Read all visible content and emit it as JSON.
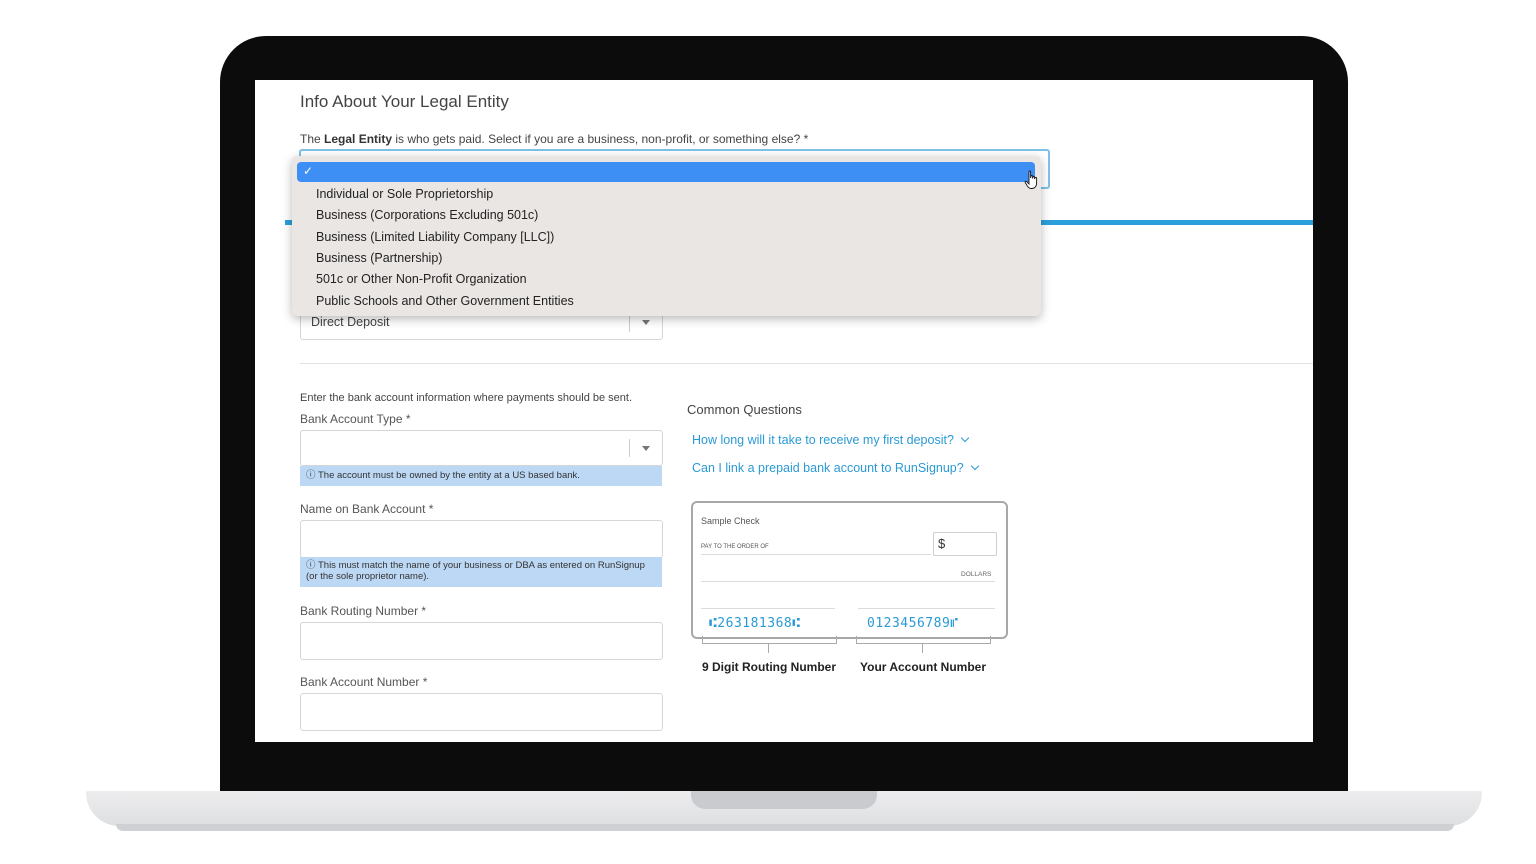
{
  "legal_entity": {
    "heading": "Info About Your Legal Entity",
    "prompt_before": "The ",
    "prompt_bold": "Legal Entity",
    "prompt_after": " is who gets paid. Select if you are a business, non-profit, or something else? *",
    "dropdown": {
      "selected_check": "✓",
      "options": [
        "Individual or Sole Proprietorship",
        "Business (Corporations Excluding 501c)",
        "Business (Limited Liability Company [LLC])",
        "Business (Partnership)",
        "501c or Other Non-Profit Organization",
        "Public Schools and Other Government Entities"
      ]
    }
  },
  "payment_method": {
    "value": "Direct Deposit"
  },
  "bank": {
    "instructions": "Enter the bank account information where payments should be sent.",
    "account_type_label": "Bank Account Type *",
    "account_type_value": "",
    "account_type_note": "The account must be owned by the entity at a US based bank.",
    "name_label": "Name on Bank Account *",
    "name_value": "",
    "name_note_1": "This must match the name of your business or DBA as entered on RunSignup",
    "name_note_2": "(or the sole proprietor name).",
    "routing_label": "Bank Routing Number *",
    "routing_value": "",
    "account_label": "Bank Account Number *",
    "account_value": ""
  },
  "common_questions": {
    "heading": "Common Questions",
    "items": [
      "How long will it take to receive my first deposit?",
      "Can I link a prepaid bank account to RunSignup?"
    ]
  },
  "sample_check": {
    "title": "Sample Check",
    "pay_to": "PAY TO THE ORDER OF",
    "dollar_sign": "$",
    "dollars": "DOLLARS",
    "routing_micr": "⑆263181368⑆",
    "account_micr": "0123456789⑈",
    "routing_caption": "9 Digit Routing Number",
    "account_caption": "Your Account Number"
  },
  "colors": {
    "accent": "#2b9fdb",
    "selected_option": "#3d8ff5",
    "link": "#2a9ad6",
    "note_bg": "#bcd8f4"
  },
  "icons": [
    "check-icon",
    "hand-cursor-icon",
    "chevron-down-icon",
    "info-icon"
  ]
}
